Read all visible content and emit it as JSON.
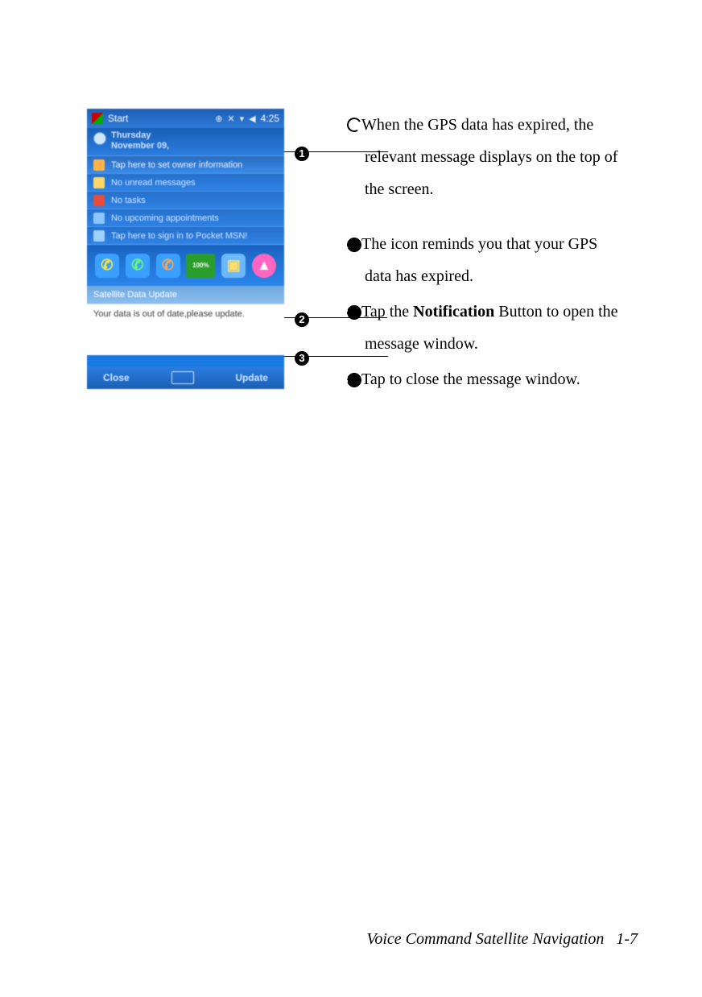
{
  "footer": {
    "title": "Voice Command Satellite Navigation",
    "page": "1-7"
  },
  "callouts": {
    "one": "1",
    "two": "2",
    "three": "3"
  },
  "device": {
    "taskbar": {
      "start": "Start",
      "time": "4:25"
    },
    "date": {
      "day": "Thursday",
      "full": "November 09,"
    },
    "items": {
      "owner": "Tap here to set owner information",
      "messages": "No unread messages",
      "tasks": "No tasks",
      "appointments": "No upcoming appointments",
      "msn": "Tap here to sign in to Pocket MSN!"
    },
    "battery": "100%",
    "notification": {
      "title": "Satellite Data Update",
      "body": "Your data is out of date,please update."
    },
    "softkeys": {
      "left": "Close",
      "right": "Update"
    }
  },
  "explain": {
    "intro": "When the GPS data has expired, the relevant message displays on the top of the screen.",
    "p1": "The icon reminds you that your GPS data has expired.",
    "p2a": "Tap the ",
    "p2b": "Notification",
    "p2c": " Button to open the message window.",
    "p3": "Tap to close the message window."
  }
}
